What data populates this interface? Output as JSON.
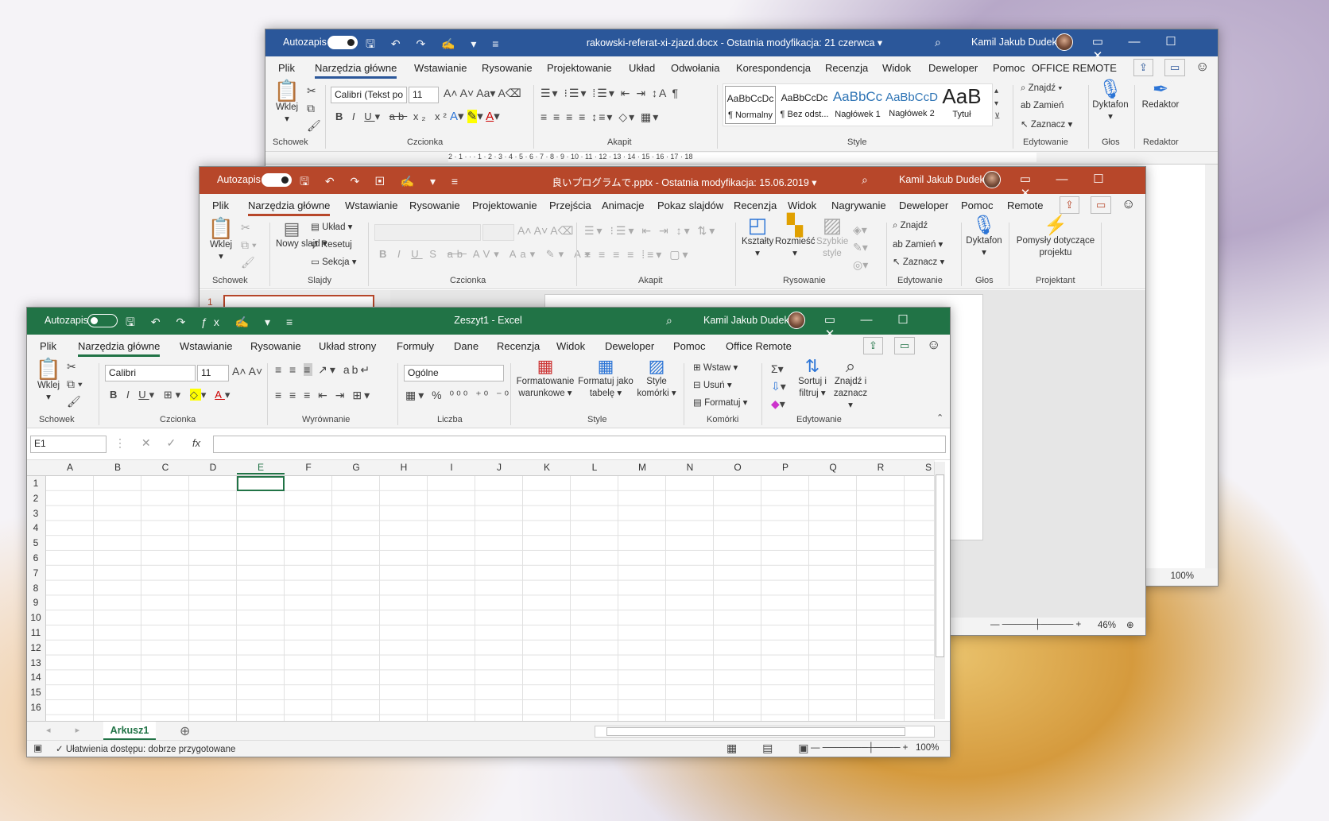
{
  "word": {
    "autosave": "Autozapis",
    "title": "rakowski-referat-xi-zjazd.docx  -  Ostatnia modyfikacja: 21 czerwca ▾",
    "user": "Kamil Jakub Dudek",
    "tabs": [
      "Plik",
      "Narzędzia główne",
      "Wstawianie",
      "Rysowanie",
      "Projektowanie",
      "Układ",
      "Odwołania",
      "Korespondencja",
      "Recenzja",
      "Widok",
      "Deweloper",
      "Pomoc",
      "OFFICE REMOTE"
    ],
    "font_name": "Calibri (Tekst po",
    "font_size": "11",
    "paste": "Wklej",
    "styles": [
      {
        "preview": "AaBbCcDc",
        "name": "¶ Normalny"
      },
      {
        "preview": "AaBbCcDc",
        "name": "¶ Bez odst..."
      },
      {
        "preview": "AaBbCc",
        "name": "Nagłówek 1"
      },
      {
        "preview": "AaBbCcD",
        "name": "Nagłówek 2"
      },
      {
        "preview": "AaB",
        "name": "Tytuł"
      }
    ],
    "find": "Znajdź",
    "replace": "Zamień",
    "select": "Zaznacz",
    "dictate": "Dyktafon",
    "editor": "Redaktor",
    "groups": {
      "clipboard": "Schowek",
      "font": "Czcionka",
      "paragraph": "Akapit",
      "styles": "Style",
      "editing": "Edytowanie",
      "voice": "Głos",
      "editor": "Redaktor"
    },
    "ruler": "2 · 1 · · · 1 · 2 · 3 · 4 · 5 · 6 · 7 · 8 · 9 · 10 · 11 · 12 · 13 · 14 · 15 · 16 · 17 · 18",
    "zoom": "100%"
  },
  "ppt": {
    "autosave": "Autozapis",
    "title": "良いプログラムで.pptx  -  Ostatnia modyfikacja: 15.06.2019 ▾",
    "user": "Kamil Jakub Dudek",
    "tabs": [
      "Plik",
      "Narzędzia główne",
      "Wstawianie",
      "Rysowanie",
      "Projektowanie",
      "Przejścia",
      "Animacje",
      "Pokaz slajdów",
      "Recenzja",
      "Widok",
      "Nagrywanie",
      "Deweloper",
      "Pomoc",
      "Remote"
    ],
    "paste": "Wklej",
    "new_slide": "Nowy slajd ▾",
    "layout": "Układ ▾",
    "reset": "Resetuj",
    "section": "Sekcja ▾",
    "shapes": "Kształty",
    "arrange": "Rozmieść",
    "quick_styles": "Szybkie style",
    "find": "Znajdź",
    "replace": "Zamień",
    "select": "Zaznacz",
    "dictate": "Dyktafon",
    "designer": "Pomysły dotyczące projektu",
    "groups": {
      "clipboard": "Schowek",
      "slides": "Slajdy",
      "font": "Czcionka",
      "paragraph": "Akapit",
      "drawing": "Rysowanie",
      "editing": "Edytowanie",
      "voice": "Głos",
      "designer": "Projektant"
    },
    "slide_num": "1",
    "zoom": "46%"
  },
  "excel": {
    "autosave": "Autozapis",
    "title": "Zeszyt1  -  Excel",
    "user": "Kamil Jakub Dudek",
    "tabs": [
      "Plik",
      "Narzędzia główne",
      "Wstawianie",
      "Rysowanie",
      "Układ strony",
      "Formuły",
      "Dane",
      "Recenzja",
      "Widok",
      "Deweloper",
      "Pomoc",
      "Office Remote"
    ],
    "paste": "Wklej",
    "font_name": "Calibri",
    "font_size": "11",
    "number_format": "Ogólne",
    "cond_format": "Formatowanie warunkowe ▾",
    "format_table": "Formatuj jako tabelę ▾",
    "cell_styles": "Style komórki ▾",
    "insert": "Wstaw",
    "delete": "Usuń",
    "format": "Formatuj",
    "sort": "Sortuj i filtruj ▾",
    "find": "Znajdź i zaznacz ▾",
    "groups": {
      "clipboard": "Schowek",
      "font": "Czcionka",
      "alignment": "Wyrównanie",
      "number": "Liczba",
      "styles": "Style",
      "cells": "Komórki",
      "editing": "Edytowanie"
    },
    "name_box": "E1",
    "fx": "fx",
    "columns": [
      "A",
      "B",
      "C",
      "D",
      "E",
      "F",
      "G",
      "H",
      "I",
      "J",
      "K",
      "L",
      "M",
      "N",
      "O",
      "P",
      "Q",
      "R",
      "S"
    ],
    "rows": [
      "1",
      "2",
      "3",
      "4",
      "5",
      "6",
      "7",
      "8",
      "9",
      "10",
      "11",
      "12",
      "13",
      "14",
      "15",
      "16"
    ],
    "sheet": "Arkusz1",
    "status": "Ułatwienia dostępu: dobrze przygotowane",
    "zoom": "100%"
  },
  "colors": {
    "word": "#2b579a",
    "ppt": "#b7472a",
    "excel": "#217346"
  }
}
